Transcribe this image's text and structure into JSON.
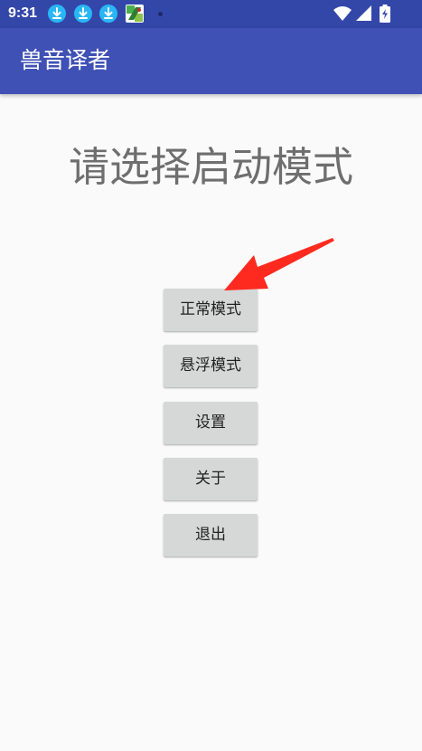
{
  "status_bar": {
    "time": "9:31",
    "icons": [
      "download-icon",
      "download-icon",
      "download-icon",
      "app-notification-icon",
      "notification-dot",
      "wifi-icon",
      "signal-icon",
      "battery-charging-icon"
    ]
  },
  "app_bar": {
    "title": "兽音译者"
  },
  "main": {
    "heading": "请选择启动模式",
    "buttons": [
      {
        "label": "正常模式"
      },
      {
        "label": "悬浮模式"
      },
      {
        "label": "设置"
      },
      {
        "label": "关于"
      },
      {
        "label": "退出"
      }
    ]
  },
  "colors": {
    "status_bar": "#3347a8",
    "app_bar": "#3f51b5",
    "background": "#fafafa",
    "button": "#d6d7d7",
    "heading_text": "#6e6e6e",
    "annotation_arrow": "#ff2a1f",
    "download_icon": "#29b6f6"
  }
}
